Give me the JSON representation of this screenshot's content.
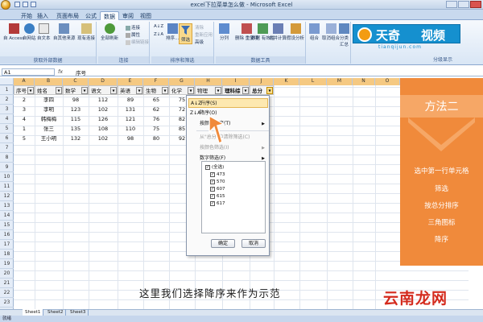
{
  "window": {
    "title": "excel下拉菜单怎么做 - Microsoft Excel"
  },
  "tabs": [
    "开始",
    "插入",
    "页面布局",
    "公式",
    "数据",
    "审阅",
    "视图"
  ],
  "active_tab": "数据",
  "ribbon": {
    "group_external": {
      "label": "获取外部数据",
      "buttons": [
        "自 Access",
        "自网站",
        "自文本",
        "自其他来源",
        "现有连接"
      ]
    },
    "group_connections": {
      "label": "连接",
      "refresh": "全部刷新",
      "items": [
        "连接",
        "属性",
        "编辑链接"
      ]
    },
    "group_sort_filter": {
      "label": "排序和筛选",
      "sort_asc": "A↓Z",
      "sort_desc": "Z↓A",
      "sort": "排序...",
      "filter": "筛选",
      "items": [
        "清除",
        "重新应用",
        "高级"
      ]
    },
    "group_data_tools": {
      "label": "数据工具",
      "buttons": [
        "分列",
        "删除\n重复项",
        "数据\n有效性",
        "合并计算",
        "假设分析"
      ]
    },
    "group_outline": {
      "label": "分级显示",
      "buttons": [
        "组合",
        "取消组合",
        "分类汇总"
      ]
    }
  },
  "logo": {
    "part1": "天奇",
    "part2": "视频",
    "url": "tianqijun.com"
  },
  "formula_bar": {
    "name_box": "A1",
    "fx": "fx",
    "value": "序号"
  },
  "columns": [
    "A",
    "B",
    "C",
    "D",
    "E",
    "F",
    "G",
    "H",
    "I",
    "J",
    "K",
    "L",
    "M",
    "N",
    "O",
    "P"
  ],
  "rows": [
    "1",
    "2",
    "3",
    "4",
    "5",
    "6",
    "7",
    "8",
    "9",
    "10",
    "11",
    "12",
    "13",
    "14",
    "15",
    "16",
    "17",
    "18",
    "19",
    "20",
    "21",
    "22",
    "23"
  ],
  "sheet": {
    "headers": [
      "序号",
      "姓名",
      "数学",
      "语文",
      "英语",
      "生物",
      "化学",
      "物理",
      "理科综",
      "总分"
    ],
    "data": [
      [
        "2",
        "李四",
        "98",
        "112",
        "89",
        "65",
        "75"
      ],
      [
        "3",
        "李明",
        "123",
        "102",
        "131",
        "62",
        "72"
      ],
      [
        "4",
        "韩梅梅",
        "115",
        "126",
        "121",
        "76",
        "82"
      ],
      [
        "1",
        "张三",
        "135",
        "108",
        "110",
        "75",
        "85"
      ],
      [
        "5",
        "王小明",
        "132",
        "102",
        "98",
        "80",
        "92"
      ]
    ]
  },
  "filter_menu": {
    "items": [
      {
        "icon": "A↓Z",
        "label": "升序(S)"
      },
      {
        "icon": "Z↓A",
        "label": "降序(O)"
      },
      {
        "icon": "",
        "label": "按颜色排序(T)"
      },
      {
        "icon": "",
        "label": "从\"总分\"中清除筛选(C)"
      },
      {
        "icon": "",
        "label": "按颜色筛选(I)"
      },
      {
        "icon": "",
        "label": "数字筛选(F)"
      }
    ],
    "list": [
      {
        "label": "(全选)",
        "checked": true
      },
      {
        "label": "473",
        "checked": true
      },
      {
        "label": "570",
        "checked": true
      },
      {
        "label": "607",
        "checked": true
      },
      {
        "label": "615",
        "checked": true
      },
      {
        "label": "617",
        "checked": true
      }
    ],
    "ok": "确定",
    "cancel": "取消"
  },
  "panel": {
    "title": "方法二",
    "steps": [
      "选中第一行单元格",
      "筛选",
      "按总分排序",
      "三角图标",
      "降序"
    ],
    "color": "#f08a3b"
  },
  "caption": "这里我们选择降序来作为示范",
  "watermark": "云南龙网",
  "sheet_tabs": [
    "Sheet1",
    "Sheet2",
    "Sheet3"
  ],
  "status": "就绪"
}
